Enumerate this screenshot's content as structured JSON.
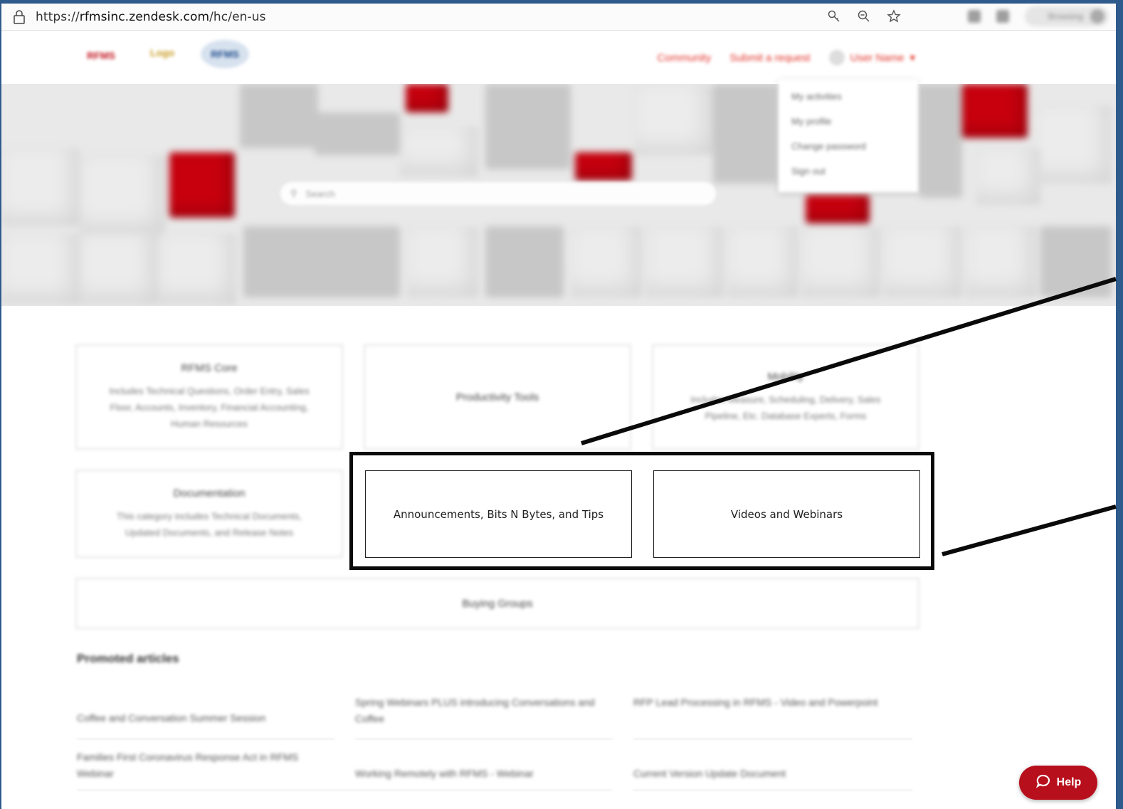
{
  "browser": {
    "url_prefix": "https://",
    "url_domain": "rfmsinc.zendesk.com",
    "url_path": "/hc/en-us",
    "icons": [
      "key-icon",
      "zoom-out-icon",
      "star-icon"
    ],
    "profile_label": "Browsing"
  },
  "header": {
    "logos": [
      "RFMS",
      "Logo",
      "RFMS"
    ],
    "nav": {
      "community": "Community",
      "submit_request": "Submit a request",
      "user_name": "User Name"
    }
  },
  "hero": {
    "search_placeholder": "Search",
    "user_menu": [
      "My activities",
      "My profile",
      "Change password",
      "Sign out"
    ]
  },
  "categories": {
    "rfms_core": {
      "title": "RFMS Core",
      "description": "Includes Technical Questions, Order Entry, Sales Floor, Accounts, Inventory, Financial Accounting, Human Resources"
    },
    "productivity_tools": {
      "title": "Productivity Tools"
    },
    "mobility": {
      "title": "Mobility",
      "description": "Includes Measure, Scheduling, Delivery, Sales Pipeline, Etc. Database Experts, Forms"
    },
    "documentation": {
      "title": "Documentation",
      "description": "This category includes Technical Documents, Updated Documents, and Release Notes"
    },
    "announcements": {
      "title": "Announcements, Bits N Bytes, and Tips"
    },
    "videos": {
      "title": "Videos and Webinars"
    },
    "buying_groups": {
      "title": "Buying Groups"
    }
  },
  "promoted": {
    "title": "Promoted articles",
    "articles": [
      "Coffee and Conversation Summer Session",
      "Spring Webinars PLUS introducing Conversations and Coffee",
      "RFP Lead Processing in RFMS - Video and Powerpoint",
      "Families First Coronavirus Response Act in RFMS Webinar",
      "Working Remotely with RFMS - Webinar",
      "Current Version Update Document"
    ]
  },
  "help_button": {
    "label": "Help"
  }
}
